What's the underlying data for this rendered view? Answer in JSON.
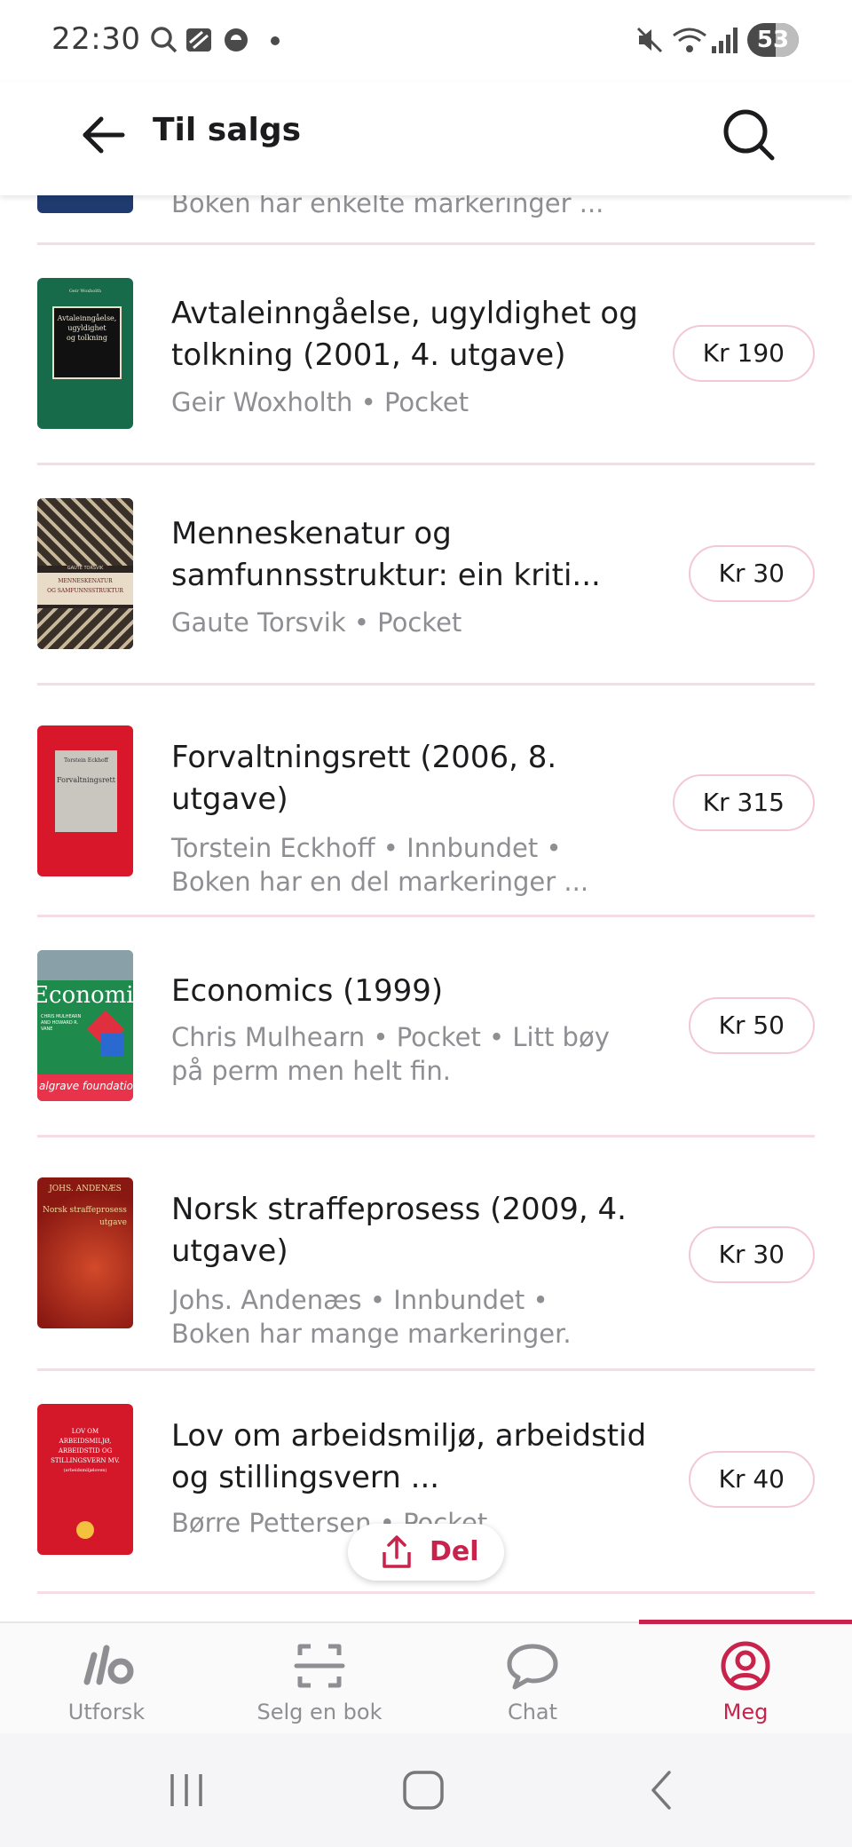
{
  "status_bar": {
    "time": "22:30",
    "battery": "53"
  },
  "header": {
    "title": "Til salgs"
  },
  "listings_partial": {
    "subtitle": "Boken har enkelte markeringer ..."
  },
  "listings": [
    {
      "title": "Avtaleinngåelse, ugyldighet og tolkning (2001, 4. utgave)",
      "subtitle": "Geir Woxholth • Pocket",
      "price": "Kr 190"
    },
    {
      "title": "Menneskenatur og samfunnsstruktur: ein kriti...",
      "subtitle": "Gaute Torsvik • Pocket",
      "price": "Kr 30"
    },
    {
      "title": "Forvaltningsrett (2006, 8. utgave)",
      "subtitle": "Torstein Eckhoff • Innbundet • Boken har en del markeringer ...",
      "price": "Kr 315"
    },
    {
      "title": "Economics (1999)",
      "subtitle": "Chris Mulhearn • Pocket • Litt bøy på perm men helt fin.",
      "price": "Kr 50"
    },
    {
      "title": "Norsk straffeprosess (2009, 4. utgave)",
      "subtitle": "Johs. Andenæs • Innbundet • Boken har mange markeringer.",
      "price": "Kr 30"
    },
    {
      "title": "Lov om arbeidsmiljø, arbeidstid og stillingsvern ...",
      "subtitle": "Børre Pettersen • Pocket",
      "price": "Kr 40"
    }
  ],
  "covers": {
    "c1": {
      "lines": [
        "Avtaleinngåelse,",
        "ugyldighet",
        "og tolkning"
      ],
      "author": "Geir Woxholth"
    },
    "c2": {
      "lines": [
        "MENNESKENATUR",
        "OG SAMFUNNSSTRUKTUR"
      ],
      "author": "GAUTE TORSVIK"
    },
    "c3": {
      "lines": [
        "Forvaltningsrett"
      ],
      "author": "Torstein Eckhoff"
    },
    "c4": {
      "lines": [
        "Economics"
      ],
      "author": "CHRIS MULHEARN AND HOWARD R. VANE",
      "footer": "algrave foundations"
    },
    "c5": {
      "lines": [
        "Norsk straffeprosess",
        "utgave"
      ],
      "author": "JOHS. ANDENÆS"
    },
    "c6": {
      "lines": [
        "LOV OM",
        "ARBEIDSMILJØ,",
        "ARBEIDSTID OG",
        "STILLINGSVERN MV."
      ],
      "author": "(arbeidsmiljøloven)"
    }
  },
  "share": {
    "label": "Del"
  },
  "bottom_nav": {
    "items": [
      {
        "label": "Utforsk",
        "icon": "explore-logo-icon"
      },
      {
        "label": "Selg en bok",
        "icon": "scan-icon"
      },
      {
        "label": "Chat",
        "icon": "chat-bubble-icon"
      },
      {
        "label": "Meg",
        "icon": "profile-icon"
      }
    ],
    "active_index": 3
  },
  "colors": {
    "accent": "#c8234b",
    "divider": "#f6dde3",
    "price_border": "#f2c9d3",
    "muted": "#8e8e93"
  }
}
